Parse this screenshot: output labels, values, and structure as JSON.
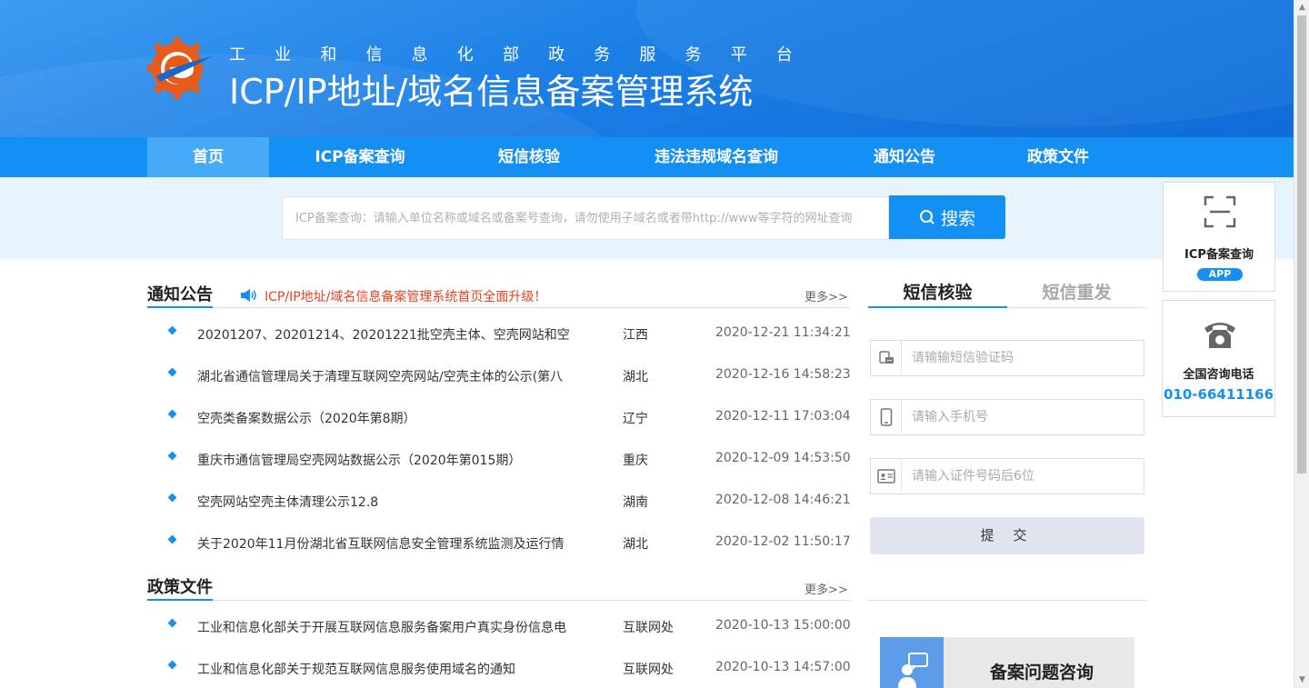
{
  "header": {
    "subtitle_chars": [
      "工",
      "业",
      "和",
      "信",
      "息",
      "化",
      "部",
      "政",
      "务",
      "服",
      "务",
      "平",
      "台"
    ],
    "title": "ICP/IP地址/域名信息备案管理系统"
  },
  "nav": [
    {
      "label": "首页",
      "active": true
    },
    {
      "label": "ICP备案查询",
      "active": false
    },
    {
      "label": "短信核验",
      "active": false
    },
    {
      "label": "违法违规域名查询",
      "active": false
    },
    {
      "label": "通知公告",
      "active": false
    },
    {
      "label": "政策文件",
      "active": false
    }
  ],
  "search": {
    "placeholder": "ICP备案查询：请输入单位名称或域名或备案号查询，请勿使用子域名或者带http://www等字符的网址查询",
    "button_label": "搜索"
  },
  "notices": {
    "title": "通知公告",
    "marquee": "ICP/IP地址/域名信息备案管理系统首页全面升级！",
    "more": "更多>>",
    "items": [
      {
        "text": "20201207、20201214、20201221批空壳主体、空壳网站和空",
        "province": "江西",
        "date": "2020-12-21 11:34:21"
      },
      {
        "text": "湖北省通信管理局关于清理互联网空壳网站/空壳主体的公示(第八",
        "province": "湖北",
        "date": "2020-12-16 14:58:23"
      },
      {
        "text": "空壳类备案数据公示（2020年第8期）",
        "province": "辽宁",
        "date": "2020-12-11 17:03:04"
      },
      {
        "text": "重庆市通信管理局空壳网站数据公示（2020年第015期）",
        "province": "重庆",
        "date": "2020-12-09 14:53:50"
      },
      {
        "text": "空壳网站空壳主体清理公示12.8",
        "province": "湖南",
        "date": "2020-12-08 14:46:21"
      },
      {
        "text": "关于2020年11月份湖北省互联网信息安全管理系统监测及运行情",
        "province": "湖北",
        "date": "2020-12-02 11:50:17"
      }
    ]
  },
  "policies": {
    "title": "政策文件",
    "more": "更多>>",
    "items": [
      {
        "text": "工业和信息化部关于开展互联网信息服务备案用户真实身份信息电",
        "province": "互联网处",
        "date": "2020-10-13 15:00:00"
      },
      {
        "text": "工业和信息化部关于规范互联网信息服务使用域名的通知",
        "province": "互联网处",
        "date": "2020-10-13 14:57:00"
      }
    ]
  },
  "sms": {
    "tab_verify": "短信核验",
    "tab_resend": "短信重发",
    "code_placeholder": "请输输短信验证码",
    "phone_placeholder": "请输入手机号",
    "id_placeholder": "请输入证件号码后6位",
    "submit": "提 交",
    "consult": "备案问题咨询"
  },
  "float": {
    "app_label": "ICP备案查询",
    "app_badge": "APP",
    "phone_label": "全国咨询电话",
    "phone_number": "010-66411166"
  },
  "colors": {
    "primary": "#1490f5",
    "nav_active": "#45aaf7",
    "alert": "#e8411f"
  }
}
